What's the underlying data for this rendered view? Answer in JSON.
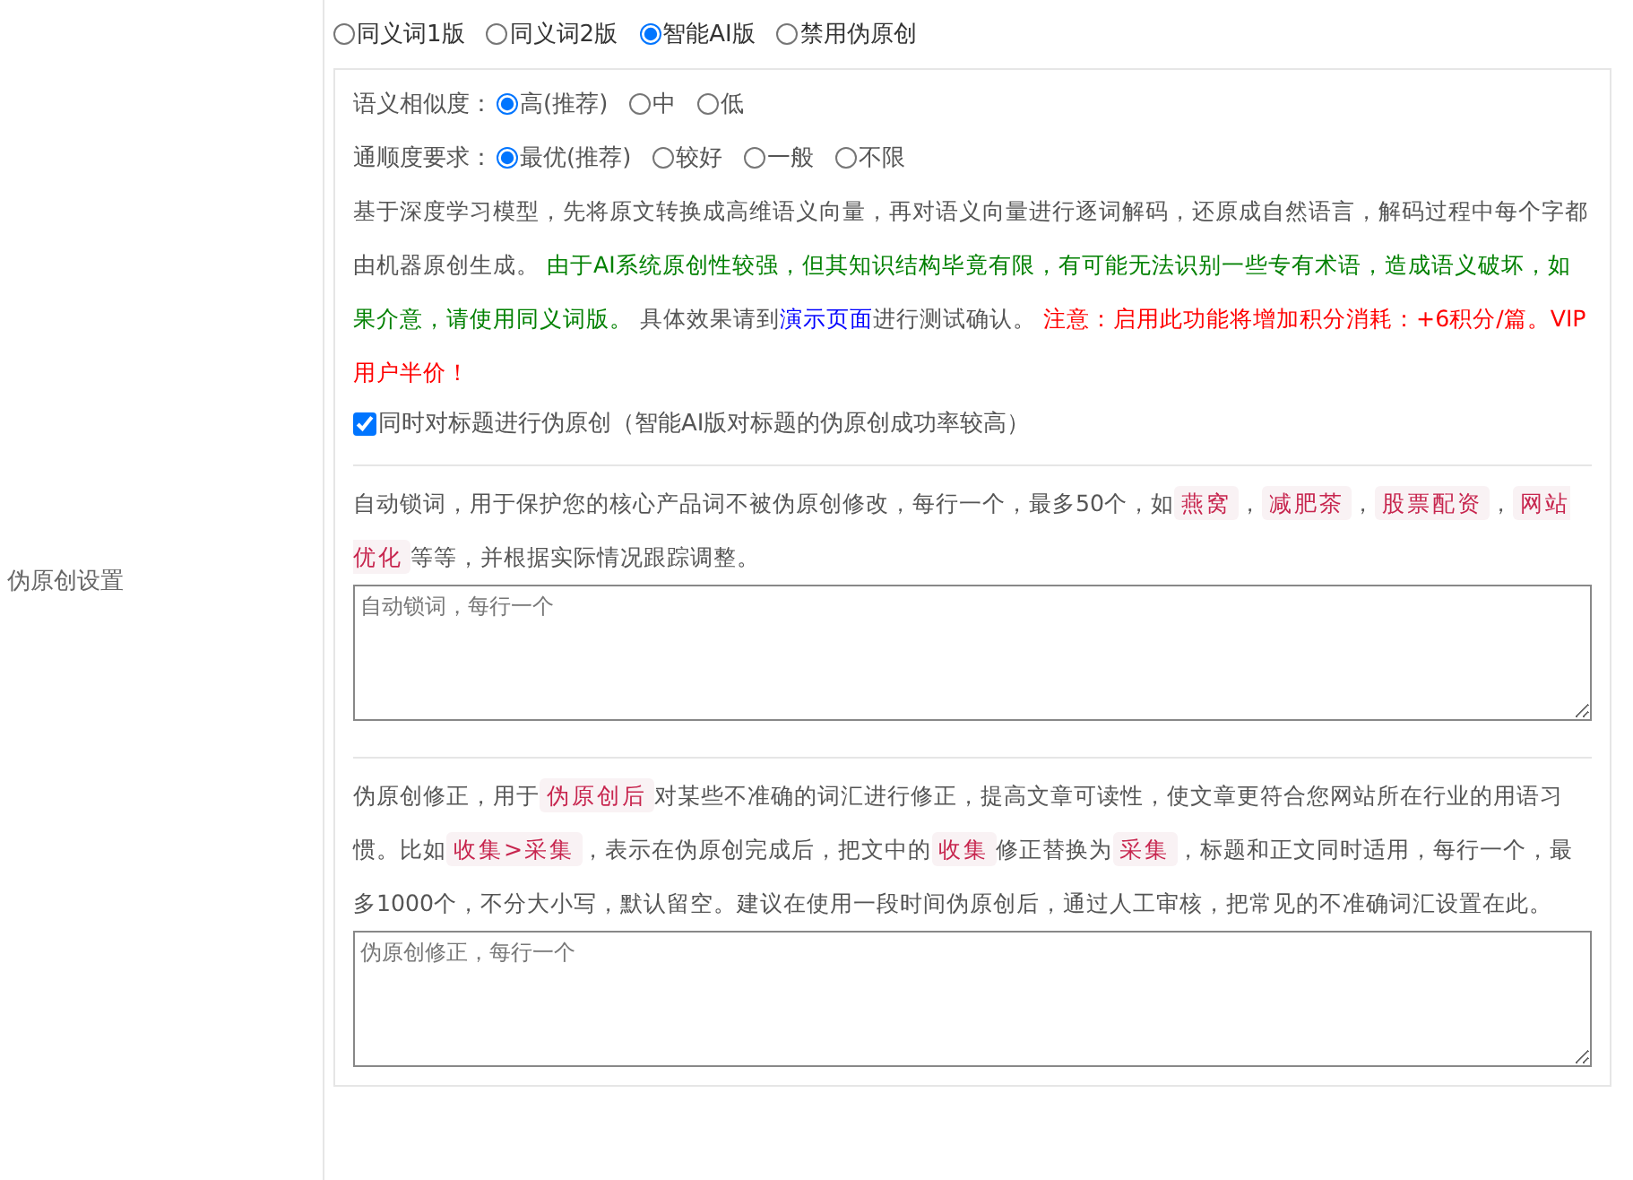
{
  "mode_options": [
    {
      "label": "同义词1版",
      "selected": false
    },
    {
      "label": "同义词2版",
      "selected": false
    },
    {
      "label": "智能AI版",
      "selected": true
    },
    {
      "label": "禁用伪原创",
      "selected": false
    }
  ],
  "side_label": "伪原创设置",
  "ai_panel": {
    "settings": [
      {
        "label": "语义相似度：",
        "options": [
          {
            "label": "高(推荐)",
            "selected": true
          },
          {
            "label": "中",
            "selected": false
          },
          {
            "label": "低",
            "selected": false
          }
        ]
      },
      {
        "label": "通顺度要求：",
        "options": [
          {
            "label": "最优(推荐)",
            "selected": true
          },
          {
            "label": "较好",
            "selected": false
          },
          {
            "label": "一般",
            "selected": false
          },
          {
            "label": "不限",
            "selected": false
          }
        ]
      }
    ],
    "description": [
      {
        "kind": "text",
        "text": "基于深度学习模型，先将原文转换成高维语义向量，再对语义向量进行逐词解码，还原成自然语言，解码过程中每个字都由机器原创生成。 "
      },
      {
        "kind": "green",
        "text": "由于AI系统原创性较强，但其知识结构毕竟有限，有可能无法识别一些专有术语，造成语义破坏，如果介意，请使用同义词版。"
      },
      {
        "kind": "text",
        "text": " 具体效果请到"
      },
      {
        "kind": "link",
        "text": "演示页面"
      },
      {
        "kind": "text",
        "text": "进行测试确认。 "
      },
      {
        "kind": "red",
        "text": "注意：启用此功能将增加积分消耗：+6积分/篇。VIP用户半价！"
      }
    ],
    "title_option": {
      "label": "同时对标题进行伪原创（智能AI版对标题的伪原创成功率较高）",
      "checked": true
    }
  },
  "lock_words": {
    "description": [
      {
        "kind": "text",
        "text": "自动锁词，用于保护您的核心产品词不被伪原创修改，每行一个，最多50个，如"
      },
      {
        "kind": "tag",
        "text": "燕窝"
      },
      {
        "kind": "text",
        "text": "，"
      },
      {
        "kind": "tag",
        "text": "减肥茶"
      },
      {
        "kind": "text",
        "text": "，"
      },
      {
        "kind": "tag",
        "text": "股票配资"
      },
      {
        "kind": "text",
        "text": "，"
      },
      {
        "kind": "tag",
        "text": "网站优化"
      },
      {
        "kind": "text",
        "text": "等等，并根据实际情况跟踪调整。"
      }
    ],
    "placeholder": "自动锁词，每行一个"
  },
  "correction": {
    "description": [
      {
        "kind": "text",
        "text": "伪原创修正，用于"
      },
      {
        "kind": "tag",
        "text": "伪原创后"
      },
      {
        "kind": "text",
        "text": "对某些不准确的词汇进行修正，提高文章可读性，使文章更符合您网站所在行业的用语习惯。比如"
      },
      {
        "kind": "tag",
        "text": "收集>采集"
      },
      {
        "kind": "text",
        "text": "，表示在伪原创完成后，把文中的"
      },
      {
        "kind": "tag",
        "text": "收集"
      },
      {
        "kind": "text",
        "text": "修正替换为"
      },
      {
        "kind": "tag",
        "text": "采集"
      },
      {
        "kind": "text",
        "text": "，标题和正文同时适用，每行一个，最多1000个，不分大小写，默认留空。建议在使用一段时间伪原创后，通过人工审核，把常见的不准确词汇设置在此。"
      }
    ],
    "placeholder": "伪原创修正，每行一个"
  }
}
